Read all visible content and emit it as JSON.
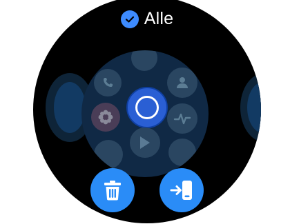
{
  "header": {
    "label": "Alle",
    "check_icon": "checkmark-circle-icon",
    "accent": "#3d8bff"
  },
  "apps_preview": {
    "apps": [
      {
        "name": "app-top",
        "icon": "blank"
      },
      {
        "name": "phone",
        "icon": "phone-icon"
      },
      {
        "name": "contacts",
        "icon": "person-icon"
      },
      {
        "name": "settings",
        "icon": "flower-icon"
      },
      {
        "name": "selected-app",
        "icon": "selected-ring-icon"
      },
      {
        "name": "health",
        "icon": "heart-rate-icon"
      },
      {
        "name": "play-store",
        "icon": "play-icon"
      },
      {
        "name": "app-bottom-left",
        "icon": "blank"
      },
      {
        "name": "app-bottom-right",
        "icon": "blank"
      }
    ]
  },
  "actions": {
    "delete_icon": "trash-icon",
    "move_icon": "send-to-phone-icon",
    "button_color": "#2a8cf7"
  },
  "colors": {
    "background": "#000000",
    "preview_bg": "#102945",
    "app_bg": "#2a4661",
    "selected": "#2a5fd4"
  }
}
